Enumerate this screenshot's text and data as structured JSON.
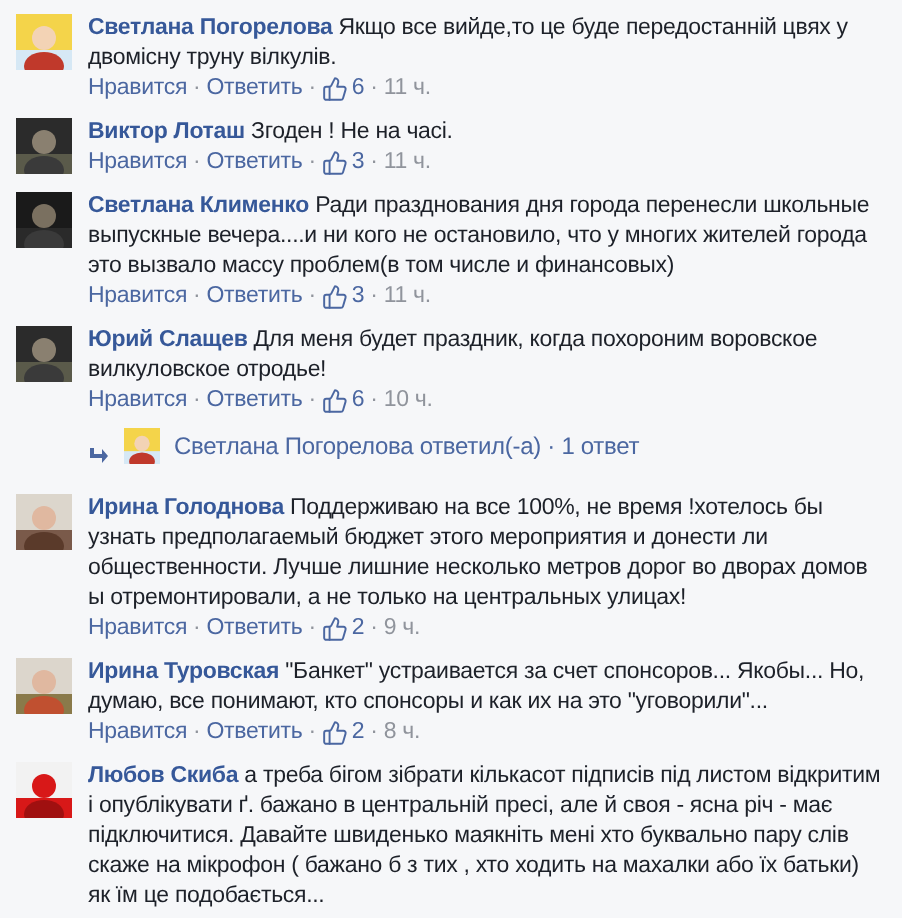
{
  "separator": "·",
  "comments": [
    {
      "author": "Светлана Погорелова",
      "text": "Якщо все вийде,то це буде передостанній цвях у двомісну труну вілкулів.",
      "like": "Нравится",
      "reply": "Ответить",
      "likes": "6",
      "time": "11 ч."
    },
    {
      "author": "Виктор Лоташ",
      "text": "Згоден ! Не на часі.",
      "like": "Нравится",
      "reply": "Ответить",
      "likes": "3",
      "time": "11 ч."
    },
    {
      "author": "Светлана Клименко",
      "text": "Ради празднования дня города перенесли школьные выпускные вечера....и ни кого не остановило, что у многих жителей города это вызвало массу проблем(в том числе и финансовых)",
      "like": "Нравится",
      "reply": "Ответить",
      "likes": "3",
      "time": "11 ч."
    },
    {
      "author": "Юрий Слащев",
      "text": "Для меня будет праздник, когда похороним воровское вилкуловское отродье!",
      "like": "Нравится",
      "reply": "Ответить",
      "likes": "6",
      "time": "10 ч.",
      "replies": {
        "author": "Светлана Погорелова",
        "label": "ответил(-а)",
        "count": "1 ответ"
      }
    },
    {
      "author": "Ирина Голоднова",
      "text": "Поддерживаю на все 100%, не время !хотелось бы узнать предполагаемый бюджет этого мероприятия и донести ли общественности. Лучше лишние несколько метров дорог во дворах домов ы отремонтировали, а не только на центральных улицах!",
      "like": "Нравится",
      "reply": "Ответить",
      "likes": "2",
      "time": "9 ч."
    },
    {
      "author": "Ирина Туровская",
      "text": "\"Банкет\" устраивается за счет спонсоров... Якобы... Но, думаю, все понимают, кто спонсоры и как их на это \"уговорили\"...",
      "like": "Нравится",
      "reply": "Ответить",
      "likes": "2",
      "time": "8 ч."
    },
    {
      "author": "Любов Скиба",
      "text": "а треба бігом зібрати кількасот підписів під листом відкритим і опублікувати ґ. бажано в центральній пресі, але й своя - ясна річ - має підключитися. Давайте швиденько маякніть мені хто буквально пару слів скаже на мікрофон ( бажано б з тих , хто ходить на махалки або їх батьки) як їм це подобається..."
    }
  ]
}
